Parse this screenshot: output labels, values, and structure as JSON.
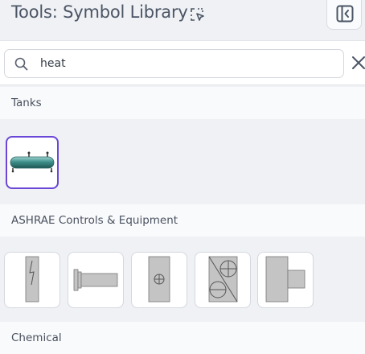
{
  "header": {
    "title": "Tools: Symbol Library",
    "title_icon": "select-region-icon",
    "collapse_icon": "panel-collapse-icon"
  },
  "search": {
    "value": "heat",
    "placeholder": "",
    "search_icon": "search-icon",
    "clear_icon": "close-icon"
  },
  "sections": [
    {
      "label": "Tanks",
      "symbols": [
        {
          "name": "horizontal-heat-exchanger-tank",
          "selected": true
        }
      ]
    },
    {
      "label": "ASHRAE Controls & Equipment",
      "symbols": [
        {
          "name": "electric-heater"
        },
        {
          "name": "heating-coil"
        },
        {
          "name": "heat-exchanger-plus"
        },
        {
          "name": "heat-recovery-wheel"
        },
        {
          "name": "duct-heater"
        }
      ]
    },
    {
      "label": "Chemical",
      "symbols": []
    }
  ],
  "colors": {
    "accent": "#6a47d6",
    "tank": "#3f8f8a",
    "symbol_fill": "#c4c4c4"
  }
}
